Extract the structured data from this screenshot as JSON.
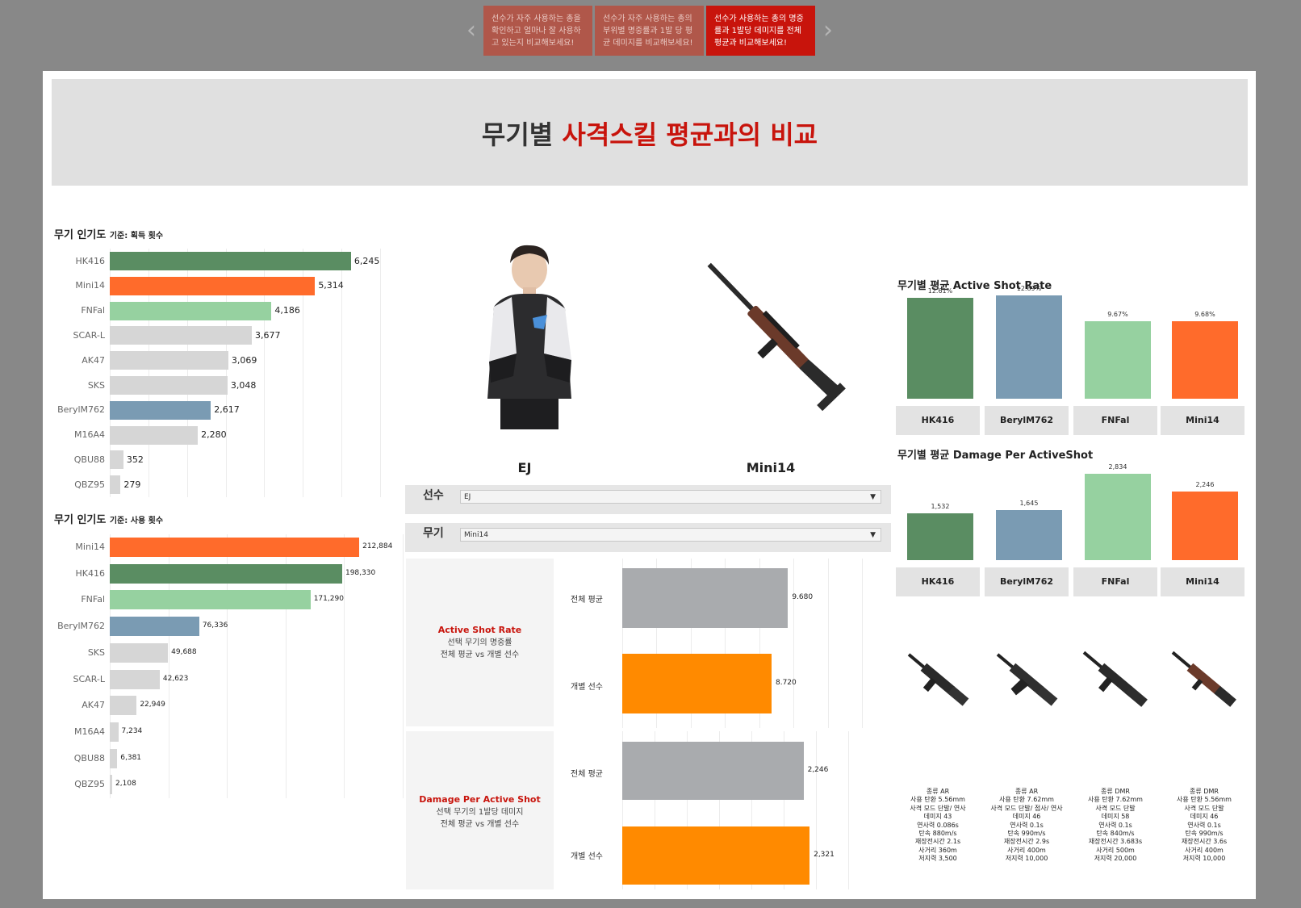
{
  "story_points": [
    {
      "text": "선수가 자주 사용하는 총을 확인하고 얼마나 잘 사용하고 있는지 비교해보세요!",
      "active": false
    },
    {
      "text": "선수가 자주 사용하는 총의 부위별 명중률과 1발 당 평균 데미지를 비교해보세요!",
      "active": false
    },
    {
      "text": "선수가 사용하는 총의 명중률과 1발당 데미지를 전체 평균과 비교해보세요!",
      "active": true
    }
  ],
  "nav": {
    "prev_icon": "‹",
    "next_icon": "›"
  },
  "title": {
    "part1": "무기별 ",
    "part2": "사격스킬 평균과의 비교"
  },
  "colors": {
    "accent": "#c8140c",
    "HK416": "#5a8d62",
    "Mini14": "#ff6b2b",
    "FNFal": "#96d1a0",
    "BerylM762": "#7a9bb3",
    "other": "#d6d6d6",
    "avg_bar": "#a9abae",
    "player_bar": "#ff8a00"
  },
  "popularity_pickup": {
    "title": "무기 인기도",
    "subtitle": "기준: 획득 횟수"
  },
  "popularity_usage": {
    "title": "무기 인기도",
    "subtitle": "기준: 사용 횟수"
  },
  "player": {
    "name": "EJ"
  },
  "weapon": {
    "name": "Mini14"
  },
  "filters": {
    "player": {
      "label": "선수",
      "value": "EJ"
    },
    "weapon": {
      "label": "무기",
      "value": "Mini14"
    }
  },
  "comparison": {
    "asr": {
      "title": "Active Shot Rate",
      "line1": "선택 무기의 명중률",
      "line2": "전체 평균 vs 개별 선수"
    },
    "dpas": {
      "title": "Damage Per Active Shot",
      "line1": "선택 무기의 1발당 데미지",
      "line2": "전체 평균  vs 개별 선수"
    },
    "avg_label": "전체 평균",
    "player_label": "개별 선수"
  },
  "avg_asr": {
    "title": "무기별 평균 Active Shot Rate"
  },
  "avg_dpas": {
    "title": "무기별 평균 Damage Per ActiveShot"
  },
  "weapon_specs": [
    {
      "lines": [
        "종류 AR",
        "사용 탄환 5.56mm",
        "사격 모드 단발/ 연사",
        "데미지 43",
        "연사력 0.086s",
        "탄속 880m/s",
        "재장전시간 2.1s",
        "사거리 360m",
        "저지력 3,500"
      ]
    },
    {
      "lines": [
        "종류 AR",
        "사용 탄환 7.62mm",
        "사격 모드 단발/ 점사/ 연사",
        "데미지 46",
        "연사력 0.1s",
        "탄속 990m/s",
        "재장전시간 2.9s",
        "사거리 400m",
        "저지력 10,000"
      ]
    },
    {
      "lines": [
        "종류 DMR",
        "사용 탄환 7.62mm",
        "사격 모드 단발",
        "데미지 58",
        "연사력 0.1s",
        "탄속 840m/s",
        "재장전시간 3.683s",
        "사거리 500m",
        "저지력 20,000"
      ]
    },
    {
      "lines": [
        "종류 DMR",
        "사용 탄환 5.56mm",
        "사격 모드 단발",
        "데미지 46",
        "연사력 0.1s",
        "탄속 990m/s",
        "재장전시간 3.6s",
        "사거리 400m",
        "저지력 10,000"
      ]
    }
  ],
  "chart_data": [
    {
      "type": "bar",
      "orientation": "horizontal",
      "title": "무기 인기도 기준: 획득 횟수",
      "categories": [
        "HK416",
        "Mini14",
        "FNFal",
        "SCAR-L",
        "AK47",
        "SKS",
        "BerylM762",
        "M16A4",
        "QBU88",
        "QBZ95"
      ],
      "values": [
        6245,
        5314,
        4186,
        3677,
        3069,
        3048,
        2617,
        2280,
        352,
        279
      ],
      "labels": [
        "6,245",
        "5,314",
        "4,186",
        "3,677",
        "3,069",
        "3,048",
        "2,617",
        "2,280",
        "352",
        "279"
      ],
      "xlim": [
        0,
        7000
      ]
    },
    {
      "type": "bar",
      "orientation": "horizontal",
      "title": "무기 인기도 기준: 사용 횟수",
      "categories": [
        "Mini14",
        "HK416",
        "FNFal",
        "BerylM762",
        "SKS",
        "SCAR-L",
        "AK47",
        "M16A4",
        "QBU88",
        "QBZ95"
      ],
      "values": [
        212884,
        198330,
        171290,
        76336,
        49688,
        42623,
        22949,
        7234,
        6381,
        2108
      ],
      "labels": [
        "212,884",
        "198,330",
        "171,290",
        "76,336",
        "49,688",
        "42,623",
        "22,949",
        "7,234",
        "6,381",
        "2,108"
      ],
      "xlim": [
        0,
        250000
      ]
    },
    {
      "type": "bar",
      "orientation": "horizontal",
      "title": "Active Shot Rate",
      "categories": [
        "전체 평균",
        "개별 선수"
      ],
      "values": [
        9.68,
        8.72
      ],
      "labels": [
        "9.680",
        "8.720"
      ],
      "xlim": [
        0,
        14
      ]
    },
    {
      "type": "bar",
      "orientation": "horizontal",
      "title": "Damage Per Active Shot",
      "categories": [
        "전체 평균",
        "개별 선수"
      ],
      "values": [
        2246,
        2321
      ],
      "labels": [
        "2,246",
        "2,321"
      ],
      "xlim": [
        0,
        2800
      ]
    },
    {
      "type": "bar",
      "orientation": "vertical",
      "title": "무기별 평균 Active Shot Rate",
      "categories": [
        "HK416",
        "BerylM762",
        "FNFal",
        "Mini14"
      ],
      "values": [
        12.61,
        12.89,
        9.67,
        9.68
      ],
      "labels": [
        "12.61%",
        "12.89%",
        "9.67%",
        "9.68%"
      ],
      "ylim": [
        0,
        14
      ]
    },
    {
      "type": "bar",
      "orientation": "vertical",
      "title": "무기별 평균 Damage Per ActiveShot",
      "categories": [
        "HK416",
        "BerylM762",
        "FNFal",
        "Mini14"
      ],
      "values": [
        1532,
        1645,
        2834,
        2246
      ],
      "labels": [
        "1,532",
        "1,645",
        "2,834",
        "2,246"
      ],
      "ylim": [
        0,
        3000
      ]
    }
  ]
}
